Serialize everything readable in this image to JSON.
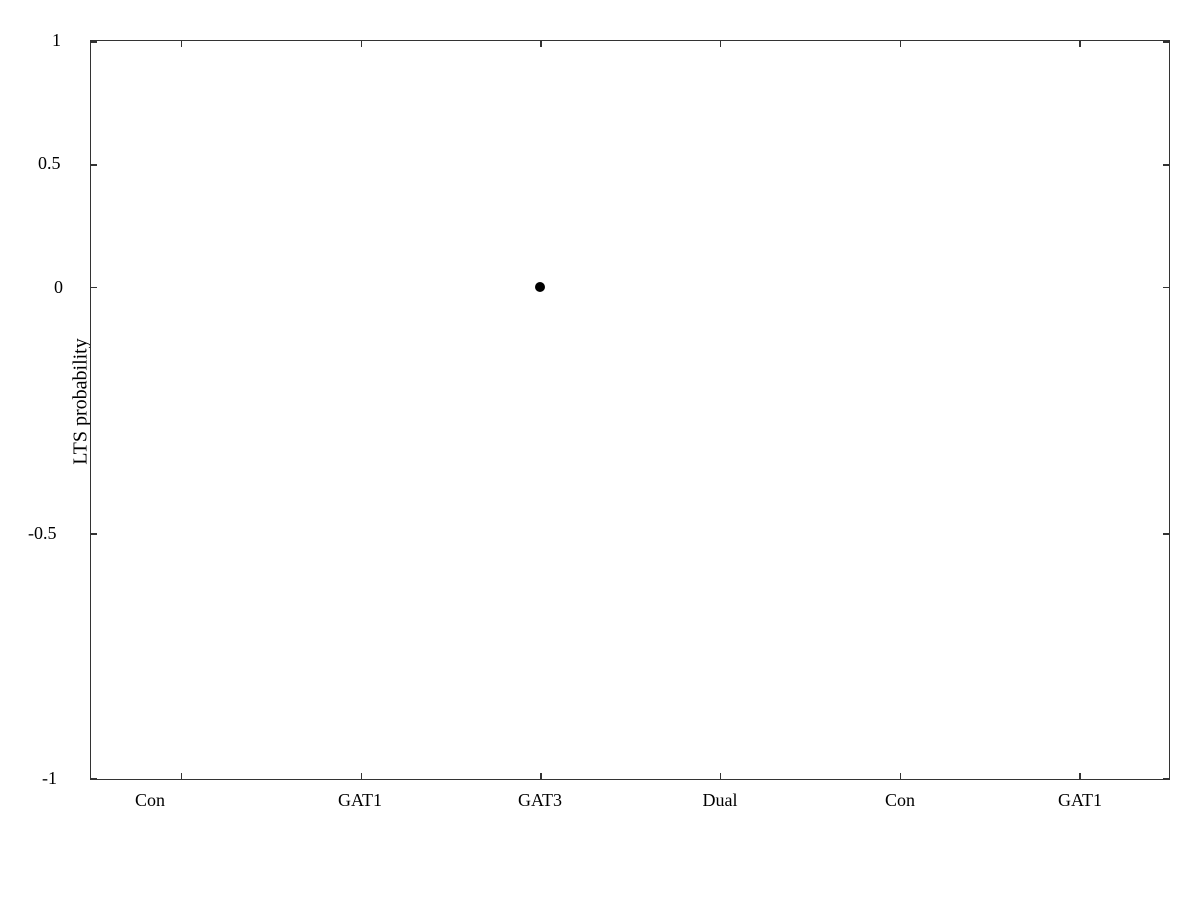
{
  "chart": {
    "title": "",
    "y_axis": {
      "label": "LTS probability",
      "ticks": [
        {
          "value": "1",
          "position_pct": 0
        },
        {
          "value": "0.5",
          "position_pct": 16.67
        },
        {
          "value": "0",
          "position_pct": 33.33
        },
        {
          "value": "-0.5",
          "position_pct": 66.67
        },
        {
          "value": "-1",
          "position_pct": 100
        }
      ]
    },
    "x_axis": {
      "ticks": [
        {
          "label": "Con",
          "position_pct": 8.33
        },
        {
          "label": "GAT1",
          "position_pct": 25
        },
        {
          "label": "GAT3",
          "position_pct": 41.67
        },
        {
          "label": "Dual",
          "position_pct": 58.33
        },
        {
          "label": "Con",
          "position_pct": 75
        },
        {
          "label": "GAT1",
          "position_pct": 91.67
        }
      ]
    },
    "data_points": [
      {
        "x_pct": 41.67,
        "y_value": 0,
        "y_pct": 50
      }
    ],
    "colors": {
      "background": "#ffffff",
      "axis": "#333333",
      "point": "#000000"
    }
  }
}
